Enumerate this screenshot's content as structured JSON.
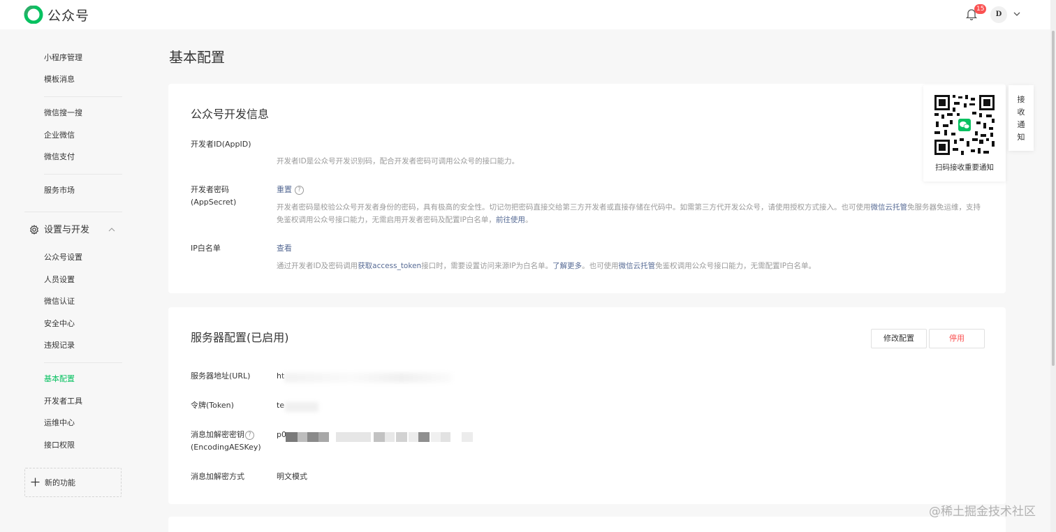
{
  "header": {
    "app_title": "公众号",
    "notification_count": "15",
    "avatar_text": "D"
  },
  "sidebar": {
    "group1": [
      "小程序管理",
      "模板消息"
    ],
    "group2": [
      "微信搜一搜",
      "企业微信",
      "微信支付"
    ],
    "group3": [
      "服务市场"
    ],
    "section_title": "设置与开发",
    "group4": [
      "公众号设置",
      "人员设置",
      "微信认证",
      "安全中心",
      "违规记录"
    ],
    "group5": [
      "基本配置",
      "开发者工具",
      "运维中心",
      "接口权限"
    ],
    "active_item": "基本配置",
    "new_feature": "新的功能"
  },
  "main": {
    "page_title": "基本配置",
    "dev_info": {
      "title": "公众号开发信息",
      "appid_label": "开发者ID(AppID)",
      "appid_desc": "开发者ID是公众号开发识别码，配合开发者密码可调用公众号的接口能力。",
      "secret_label": "开发者密码(AppSecret)",
      "secret_action": "重置",
      "secret_desc_1": "开发者密码是校验公众号开发者身份的密码，具有极高的安全性。切记勿把密码直接交给第三方开发者或直接存储在代码中。如需第三方代开发公众号，请使用授权方式接入。也可使用",
      "secret_desc_link1": "微信云托管",
      "secret_desc_2": "免服务器免运维，支持免鉴权调用公众号接口能力，无需启用开发者密码及配置IP白名单，",
      "secret_desc_link2": "前往使用",
      "secret_desc_3": "。",
      "ip_label": "IP白名单",
      "ip_action": "查看",
      "ip_desc_1": "通过开发者ID及密码调用",
      "ip_desc_link1": "获取access_token",
      "ip_desc_2": "接口时，需要设置访问来源IP为白名单。",
      "ip_desc_link2": "了解更多",
      "ip_desc_3": "。也可使用",
      "ip_desc_link3": "微信云托管",
      "ip_desc_4": "免鉴权调用公众号接口能力，无需配置IP白名单。"
    },
    "server_config": {
      "title": "服务器配置(已启用)",
      "modify_button": "修改配置",
      "stop_button": "停用",
      "url_label": "服务器地址(URL)",
      "url_value": "ht",
      "token_label": "令牌(Token)",
      "token_value": "te",
      "aeskey_label_1": "消息加解密密钥",
      "aeskey_label_2": "(EncodingAESKey)",
      "aeskey_value": "p0",
      "encrypt_label": "消息加解密方式",
      "encrypt_value": "明文模式"
    }
  },
  "qr_panel": {
    "caption": "扫码接收重要通知",
    "tab_chars": [
      "接",
      "收",
      "通",
      "知"
    ]
  },
  "watermark": "@稀土掘金技术社区",
  "colors": {
    "brand_green": "#07c160",
    "link_blue": "#576b95",
    "danger_red": "#fa5151"
  }
}
